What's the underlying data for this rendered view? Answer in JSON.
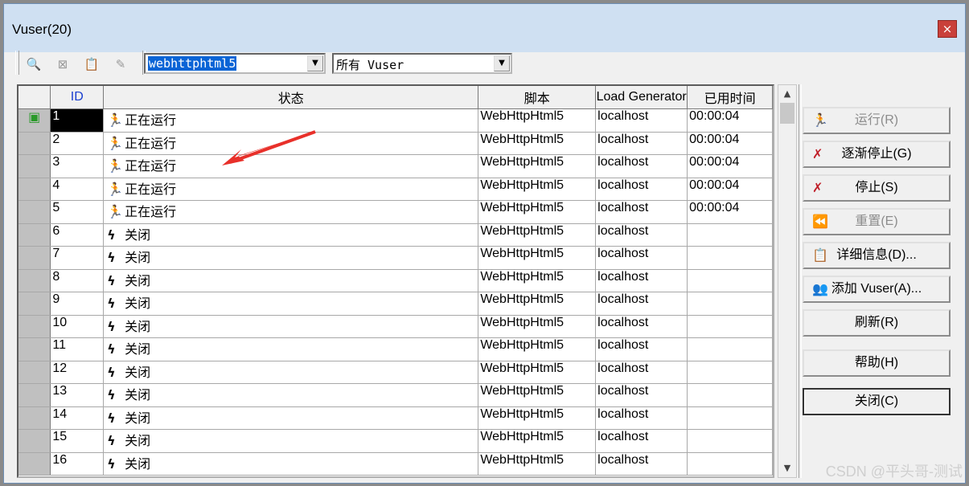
{
  "window": {
    "title": "Vuser(20)",
    "close": "×"
  },
  "toolbar": {
    "script_combo_value": "webhttphtml5",
    "group_combo_value": "所有 Vuser"
  },
  "grid": {
    "columns": [
      "ID",
      "状态",
      "脚本",
      "Load Generator",
      "已用时间"
    ],
    "rows": [
      {
        "id": "1",
        "status": "正在运行",
        "script": "WebHttpHtml5",
        "lg": "localhost",
        "elapsed": "00:00:04"
      },
      {
        "id": "2",
        "status": "正在运行",
        "script": "WebHttpHtml5",
        "lg": "localhost",
        "elapsed": "00:00:04"
      },
      {
        "id": "3",
        "status": "正在运行",
        "script": "WebHttpHtml5",
        "lg": "localhost",
        "elapsed": "00:00:04"
      },
      {
        "id": "4",
        "status": "正在运行",
        "script": "WebHttpHtml5",
        "lg": "localhost",
        "elapsed": "00:00:04"
      },
      {
        "id": "5",
        "status": "正在运行",
        "script": "WebHttpHtml5",
        "lg": "localhost",
        "elapsed": "00:00:04"
      },
      {
        "id": "6",
        "status": "关闭",
        "script": "WebHttpHtml5",
        "lg": "localhost",
        "elapsed": ""
      },
      {
        "id": "7",
        "status": "关闭",
        "script": "WebHttpHtml5",
        "lg": "localhost",
        "elapsed": ""
      },
      {
        "id": "8",
        "status": "关闭",
        "script": "WebHttpHtml5",
        "lg": "localhost",
        "elapsed": ""
      },
      {
        "id": "9",
        "status": "关闭",
        "script": "WebHttpHtml5",
        "lg": "localhost",
        "elapsed": ""
      },
      {
        "id": "10",
        "status": "关闭",
        "script": "WebHttpHtml5",
        "lg": "localhost",
        "elapsed": ""
      },
      {
        "id": "11",
        "status": "关闭",
        "script": "WebHttpHtml5",
        "lg": "localhost",
        "elapsed": ""
      },
      {
        "id": "12",
        "status": "关闭",
        "script": "WebHttpHtml5",
        "lg": "localhost",
        "elapsed": ""
      },
      {
        "id": "13",
        "status": "关闭",
        "script": "WebHttpHtml5",
        "lg": "localhost",
        "elapsed": ""
      },
      {
        "id": "14",
        "status": "关闭",
        "script": "WebHttpHtml5",
        "lg": "localhost",
        "elapsed": ""
      },
      {
        "id": "15",
        "status": "关闭",
        "script": "WebHttpHtml5",
        "lg": "localhost",
        "elapsed": ""
      },
      {
        "id": "16",
        "status": "关闭",
        "script": "WebHttpHtml5",
        "lg": "localhost",
        "elapsed": ""
      }
    ]
  },
  "buttons": {
    "run": "运行(R)",
    "gradual_stop": "逐渐停止(G)",
    "stop": "停止(S)",
    "reset": "重置(E)",
    "details": "详细信息(D)...",
    "add_vuser": "添加 Vuser(A)...",
    "refresh": "刷新(R)",
    "help": "帮助(H)",
    "close": "关闭(C)"
  },
  "watermark": "CSDN @平头哥-测试",
  "colors": {
    "title_bar": "#cfe0f2",
    "close_button": "#c9403a",
    "annotation_arrow": "#e8302a",
    "running_icon": "#1a3fcf"
  }
}
